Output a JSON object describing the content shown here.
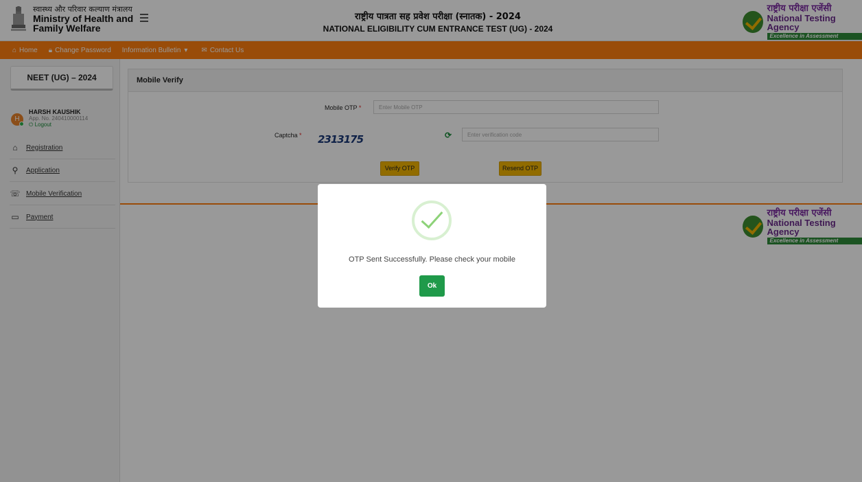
{
  "header": {
    "ministry_hindi": "स्वास्थ्य और परिवार कल्याण मंत्रालय",
    "ministry_en_line1": "Ministry of Health and",
    "ministry_en_line2": "Family Welfare",
    "title_hindi": "राष्ट्रीय पात्रता सह प्रवेश परीक्षा (स्नातक) - 2024",
    "title_en": "NATIONAL ELIGIBILITY CUM ENTRANCE TEST (UG) - 2024",
    "nta_hindi": "राष्ट्रीय परीक्षा एजेंसी",
    "nta_en": "National Testing Agency",
    "nta_tagline": "Excellence in Assessment"
  },
  "navbar": {
    "items": [
      {
        "label": "Home",
        "icon": "home-icon"
      },
      {
        "label": "Change Password",
        "icon": "lock-icon"
      },
      {
        "label": "Information Bulletin",
        "icon": "caret-down-icon"
      },
      {
        "label": "Contact Us",
        "icon": "chat-icon"
      }
    ]
  },
  "sidebar": {
    "title": "NEET (UG) – 2024",
    "user_initial": "H",
    "user_name": "HARSH KAUSHIK",
    "app_no": "App. No. 240410000114",
    "logout": "Logout",
    "items": [
      {
        "label": "Registration",
        "icon": "home-outline-icon"
      },
      {
        "label": "Application",
        "icon": "user-plus-icon"
      },
      {
        "label": "Mobile Verification",
        "icon": "phone-icon"
      },
      {
        "label": "Payment",
        "icon": "card-icon"
      }
    ]
  },
  "main": {
    "card_title": "Mobile Verify",
    "otp_label": "Mobile OTP",
    "otp_placeholder": "Enter Mobile OTP",
    "captcha_label": "Captcha",
    "captcha_text": "2313175",
    "captcha_placeholder": "Enter verification code",
    "verify_button": "Verify OTP",
    "resend_button": "Resend OTP",
    "required_mark": "*"
  },
  "modal": {
    "message": "OTP Sent Successfully. Please check your mobile",
    "ok_label": "Ok"
  },
  "colors": {
    "navbar": "#ff7f0f",
    "button_yellow": "#f2b500",
    "ok_green": "#1f9a4a"
  }
}
